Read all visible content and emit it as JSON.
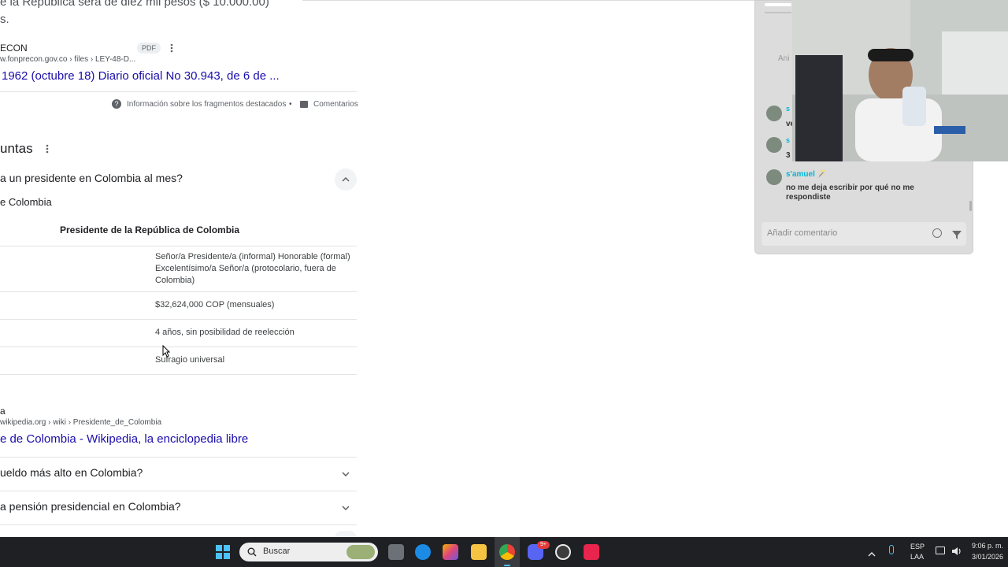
{
  "snippet": {
    "text_line1": "e la República será de diez mil pesos ($ 10.000.00)",
    "text_line2": "s.",
    "source_name": "ECON",
    "pdf_badge": "PDF",
    "url": "w.fonprecon.gov.co › files › LEY-48-D...",
    "title": "1962 (octubre 18) Diario oficial No 30.943, de 6 de ...",
    "about_label": "Información sobre los fragmentos destacados",
    "separator": "•",
    "feedback_label": "Comentarios"
  },
  "paa": {
    "heading": "untas",
    "q1": "a un presidente en Colombia al mes?",
    "q1_answer_title": "e Colombia",
    "table_header": "Presidente de la República de Colombia",
    "rows": [
      "Señor/a Presidente/a (informal) Honorable (formal) Excelentísimo/a Señor/a (protocolario, fuera de Colombia)",
      "$32,624,000 COP (mensuales)",
      "4 años, sin posibilidad de reelección",
      "Sufragio universal"
    ],
    "source2_name": "a",
    "source2_url": "wikipedia.org › wiki › Presidente_de_Colombia",
    "source2_title": "e de Colombia - Wikipedia, la enciclopedia libre",
    "q2": "ueldo más alto en Colombia?",
    "q3": "a pensión presidencial en Colombia?"
  },
  "chat": {
    "partial_label": "Ani",
    "msg1_name": "s",
    "msg1_text": "ve",
    "msg2_name": "s",
    "msg2_text": "3",
    "msg3_name": "s'amuel",
    "msg3_emoji": "🪄",
    "msg3_text": "no me deja escribir por qué no me respondiste",
    "comment_placeholder": "Añadir comentario"
  },
  "taskbar": {
    "search_placeholder": "Buscar",
    "lang_top": "ESP",
    "lang_bottom": "LAA",
    "time": "9:06 p. m.",
    "date": "3/01/2026",
    "discord_badge": "9+"
  },
  "icons": {
    "more": "more-vert-icon",
    "help": "help-circle-icon",
    "feedback": "feedback-icon",
    "chevron_up": "chevron-up-icon",
    "chevron_down": "chevron-down-icon",
    "emoji": "emoji-icon",
    "send": "send-icon",
    "windows": "windows-start-icon",
    "search": "search-icon"
  },
  "colors": {
    "link": "#1a0dab",
    "username": "#00b7d6",
    "taskbar": "#1f2023"
  }
}
